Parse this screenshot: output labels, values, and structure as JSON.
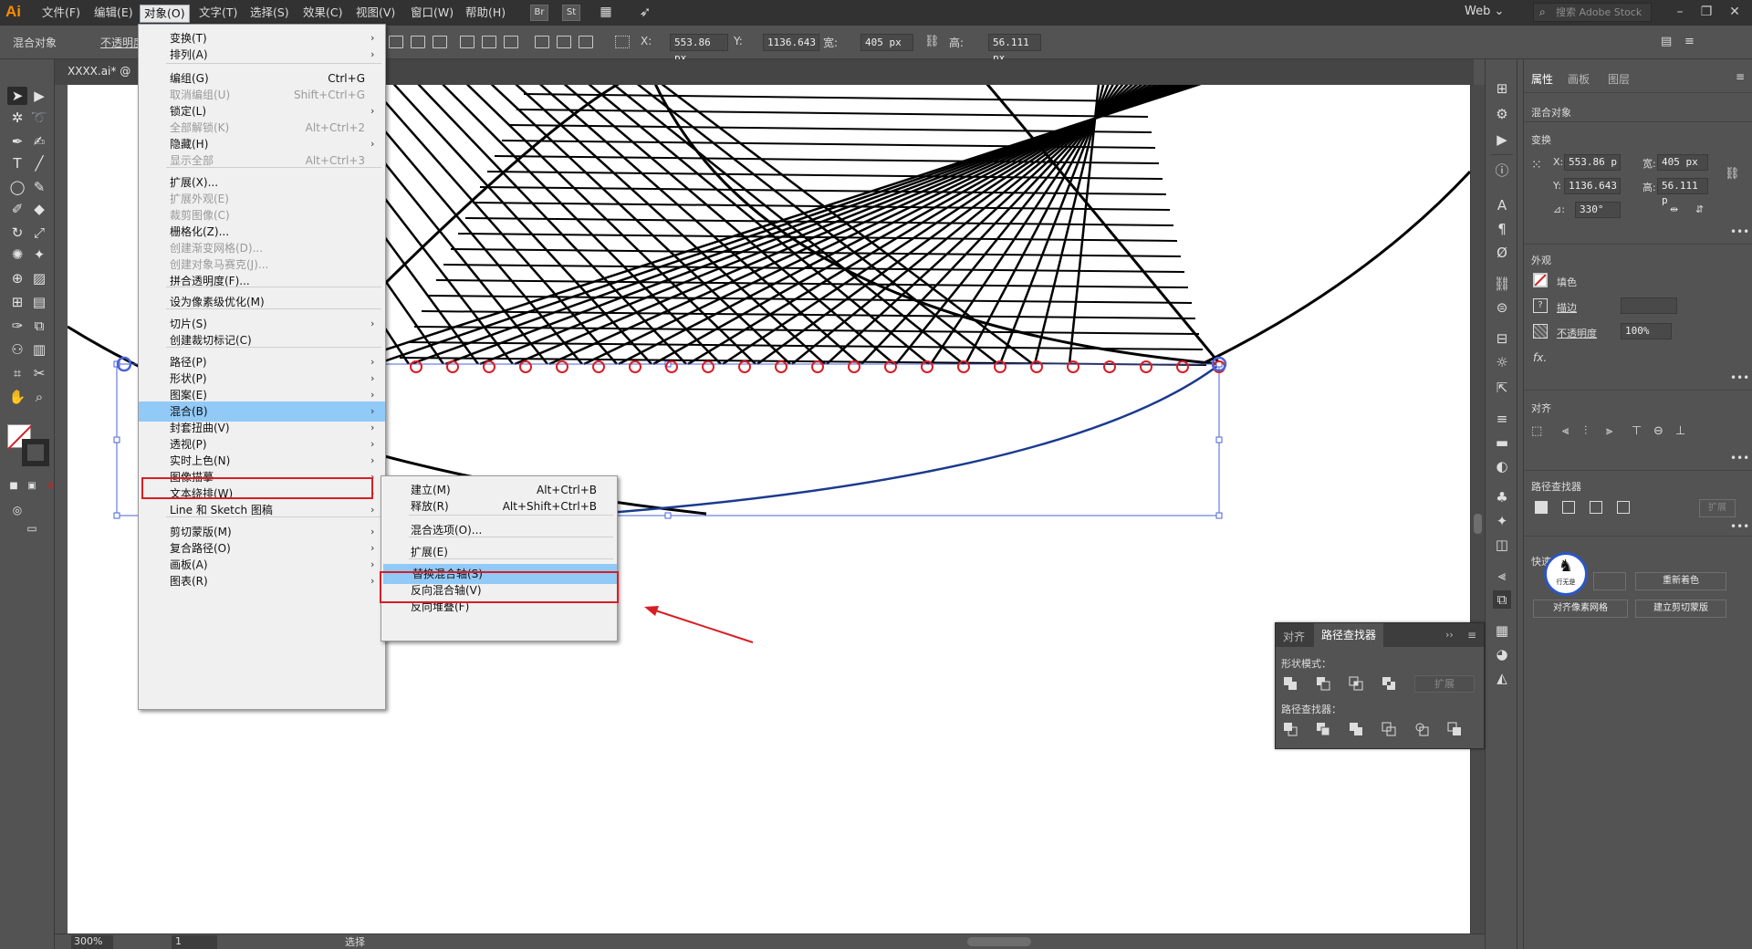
{
  "app": {
    "logo": "Ai"
  },
  "menubar": {
    "items": [
      "文件(F)",
      "编辑(E)",
      "对象(O)",
      "文字(T)",
      "选择(S)",
      "效果(C)",
      "视图(V)",
      "窗口(W)",
      "帮助(H)"
    ],
    "bridge": "Br",
    "stock": "St",
    "workspace": "Web",
    "search_placeholder": "搜索 Adobe Stock"
  },
  "control_bar": {
    "selection_type": "混合对象",
    "opacity_label": "不透明度",
    "x_label": "X:",
    "x_value": "553.86 px",
    "y_label": "Y:",
    "y_value": "1136.643",
    "w_label": "宽:",
    "w_value": "405 px",
    "h_label": "高:",
    "h_value": "56.111 px"
  },
  "document": {
    "tab_title": "XXXX.ai* @",
    "zoom": "300%",
    "page": "1",
    "status_tool": "选择"
  },
  "object_menu": {
    "items": [
      {
        "label": "变换(T)",
        "shortcut": "",
        "submenu": true,
        "disabled": false
      },
      {
        "label": "排列(A)",
        "shortcut": "",
        "submenu": true,
        "disabled": false
      },
      {
        "label": "编组(G)",
        "shortcut": "Ctrl+G",
        "submenu": false,
        "disabled": false
      },
      {
        "label": "取消编组(U)",
        "shortcut": "Shift+Ctrl+G",
        "submenu": false,
        "disabled": true
      },
      {
        "label": "锁定(L)",
        "shortcut": "",
        "submenu": true,
        "disabled": false
      },
      {
        "label": "全部解锁(K)",
        "shortcut": "Alt+Ctrl+2",
        "submenu": false,
        "disabled": true
      },
      {
        "label": "隐藏(H)",
        "shortcut": "",
        "submenu": true,
        "disabled": false
      },
      {
        "label": "显示全部",
        "shortcut": "Alt+Ctrl+3",
        "submenu": false,
        "disabled": true
      },
      {
        "label": "扩展(X)...",
        "shortcut": "",
        "submenu": false,
        "disabled": false
      },
      {
        "label": "扩展外观(E)",
        "shortcut": "",
        "submenu": false,
        "disabled": true
      },
      {
        "label": "裁剪图像(C)",
        "shortcut": "",
        "submenu": false,
        "disabled": true
      },
      {
        "label": "栅格化(Z)...",
        "shortcut": "",
        "submenu": false,
        "disabled": false
      },
      {
        "label": "创建渐变网格(D)...",
        "shortcut": "",
        "submenu": false,
        "disabled": true
      },
      {
        "label": "创建对象马赛克(J)...",
        "shortcut": "",
        "submenu": false,
        "disabled": true
      },
      {
        "label": "拼合透明度(F)...",
        "shortcut": "",
        "submenu": false,
        "disabled": false
      },
      {
        "label": "设为像素级优化(M)",
        "shortcut": "",
        "submenu": false,
        "disabled": false
      },
      {
        "label": "切片(S)",
        "shortcut": "",
        "submenu": true,
        "disabled": false
      },
      {
        "label": "创建裁切标记(C)",
        "shortcut": "",
        "submenu": false,
        "disabled": false
      },
      {
        "label": "路径(P)",
        "shortcut": "",
        "submenu": true,
        "disabled": false
      },
      {
        "label": "形状(P)",
        "shortcut": "",
        "submenu": true,
        "disabled": false
      },
      {
        "label": "图案(E)",
        "shortcut": "",
        "submenu": true,
        "disabled": false
      },
      {
        "label": "混合(B)",
        "shortcut": "",
        "submenu": true,
        "disabled": false
      },
      {
        "label": "封套扭曲(V)",
        "shortcut": "",
        "submenu": true,
        "disabled": false
      },
      {
        "label": "透视(P)",
        "shortcut": "",
        "submenu": true,
        "disabled": false
      },
      {
        "label": "实时上色(N)",
        "shortcut": "",
        "submenu": true,
        "disabled": false
      },
      {
        "label": "图像描摹",
        "shortcut": "",
        "submenu": true,
        "disabled": false
      },
      {
        "label": "文本绕排(W)",
        "shortcut": "",
        "submenu": true,
        "disabled": false
      },
      {
        "label": "Line 和 Sketch 图稿",
        "shortcut": "",
        "submenu": true,
        "disabled": false
      },
      {
        "label": "剪切蒙版(M)",
        "shortcut": "",
        "submenu": true,
        "disabled": false
      },
      {
        "label": "复合路径(O)",
        "shortcut": "",
        "submenu": true,
        "disabled": false
      },
      {
        "label": "画板(A)",
        "shortcut": "",
        "submenu": true,
        "disabled": false
      },
      {
        "label": "图表(R)",
        "shortcut": "",
        "submenu": true,
        "disabled": false
      }
    ]
  },
  "blend_submenu": {
    "items": [
      {
        "label": "建立(M)",
        "shortcut": "Alt+Ctrl+B"
      },
      {
        "label": "释放(R)",
        "shortcut": "Alt+Shift+Ctrl+B"
      },
      {
        "label": "混合选项(O)...",
        "shortcut": ""
      },
      {
        "label": "扩展(E)",
        "shortcut": ""
      },
      {
        "label": "替换混合轴(S)",
        "shortcut": ""
      },
      {
        "label": "反向混合轴(V)",
        "shortcut": ""
      },
      {
        "label": "反向堆叠(F)",
        "shortcut": ""
      }
    ]
  },
  "properties_panel": {
    "tabs": [
      "属性",
      "画板",
      "图层"
    ],
    "object_type": "混合对象",
    "transform_title": "变换",
    "x_label": "X:",
    "x_value": "553.86 p",
    "y_label": "Y:",
    "y_value": "1136.643",
    "w_label": "宽:",
    "w_value": "405 px",
    "h_label": "高:",
    "h_value": "56.111 p",
    "angle_label": "⊿:",
    "angle_value": "330°",
    "appearance_title": "外观",
    "fill_label": "填色",
    "stroke_label": "描边",
    "opacity_label": "不透明度",
    "opacity_value": "100%",
    "fx_label": "fx.",
    "align_title": "对齐",
    "pathfinder_title": "路径查找器",
    "expand_label": "扩展",
    "quick_actions_title": "快速",
    "recolor_label": "重新着色",
    "align_pixel_label": "对齐像素网格",
    "clip_mask_label": "建立剪切蒙版",
    "watermark_text": "行无是"
  },
  "floating_panel": {
    "tabs": [
      "对齐",
      "路径查找器"
    ],
    "shape_modes_label": "形状模式：",
    "pathfinders_label": "路径查找器：",
    "expand_label": "扩展"
  },
  "colors": {
    "accent_highlight": "#91c9f7",
    "annotation_red": "#d81e24",
    "selection_blue": "#4a63d8",
    "logo_orange": "#ff8a00"
  }
}
